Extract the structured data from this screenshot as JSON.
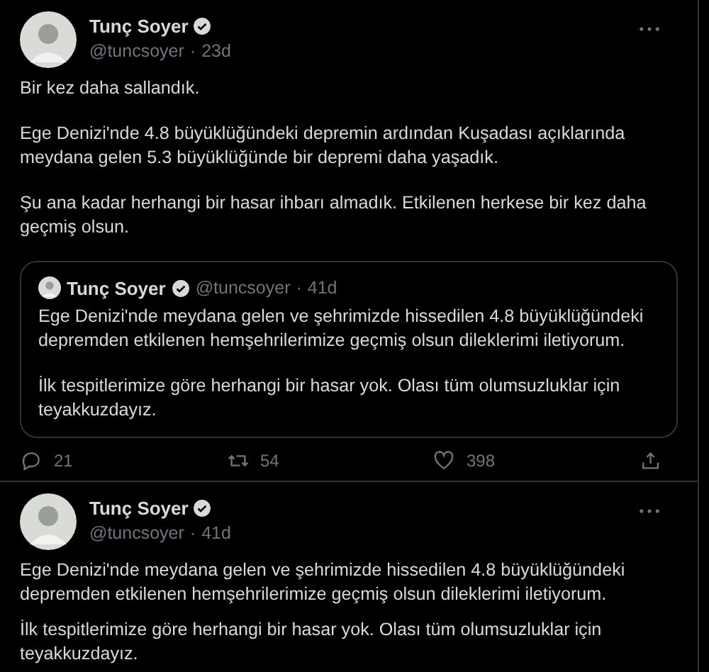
{
  "tweets": [
    {
      "name": "Tunç Soyer",
      "verified": true,
      "handle": "@tuncsoyer",
      "separator": "·",
      "time": "23d",
      "paragraphs": [
        "Bir kez daha sallandık.",
        "Ege Denizi'nde 4.8 büyüklüğündeki depremin ardından Kuşadası açıklarında\nmeydana gelen 5.3 büyüklüğünde bir depremi daha yaşadık.",
        "Şu ana kadar herhangi bir hasar ihbarı almadık. Etkilenen herkese bir kez daha\ngeçmiş olsun."
      ],
      "quote": {
        "name": "Tunç Soyer",
        "verified": true,
        "handle": "@tuncsoyer",
        "separator": "·",
        "time": "41d",
        "paragraphs": [
          "Ege Denizi'nde meydana gelen ve şehrimizde hissedilen 4.8 büyüklüğündeki\ndepremden etkilenen hemşehrilerimize geçmiş olsun dileklerimi iletiyorum.",
          "İlk tespitlerimize göre herhangi bir hasar yok. Olası tüm olumsuzluklar için\nteyakkuzdayız."
        ]
      },
      "actions": {
        "replies": "21",
        "retweets": "54",
        "likes": "398"
      }
    },
    {
      "name": "Tunç Soyer",
      "verified": true,
      "handle": "@tuncsoyer",
      "separator": "·",
      "time": "41d",
      "paragraphs": [
        "Ege Denizi'nde meydana gelen ve şehrimizde hissedilen 4.8 büyüklüğündeki\ndepremden etkilenen hemşehrilerimize geçmiş olsun dileklerimi iletiyorum.",
        "İlk tespitlerimize göre herhangi bir hasar yok. Olası tüm olumsuzluklar için\nteyakkuzdayız."
      ]
    }
  ]
}
